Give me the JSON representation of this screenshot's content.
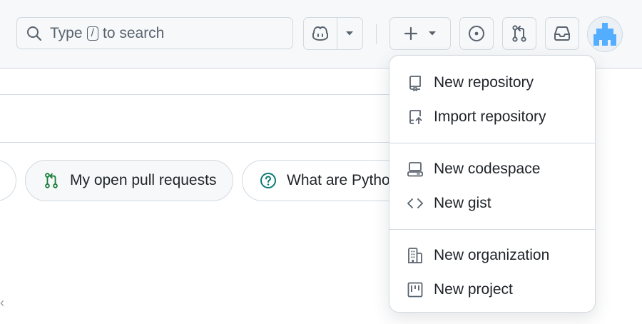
{
  "search": {
    "prefix": "Type",
    "key": "/",
    "suffix": "to search"
  },
  "chips": {
    "pull_requests": "My open pull requests",
    "question": "What are Python"
  },
  "create_menu": {
    "group1": [
      "New repository",
      "Import repository"
    ],
    "group2": [
      "New codespace",
      "New gist"
    ],
    "group3": [
      "New organization",
      "New project"
    ]
  },
  "colors": {
    "header_bg": "#f6f8fa",
    "border": "#d1d9e0",
    "icon": "#59636e",
    "pr_green": "#1a7f37",
    "question_teal": "#0e7a74",
    "avatar_blue": "#54aeff"
  }
}
